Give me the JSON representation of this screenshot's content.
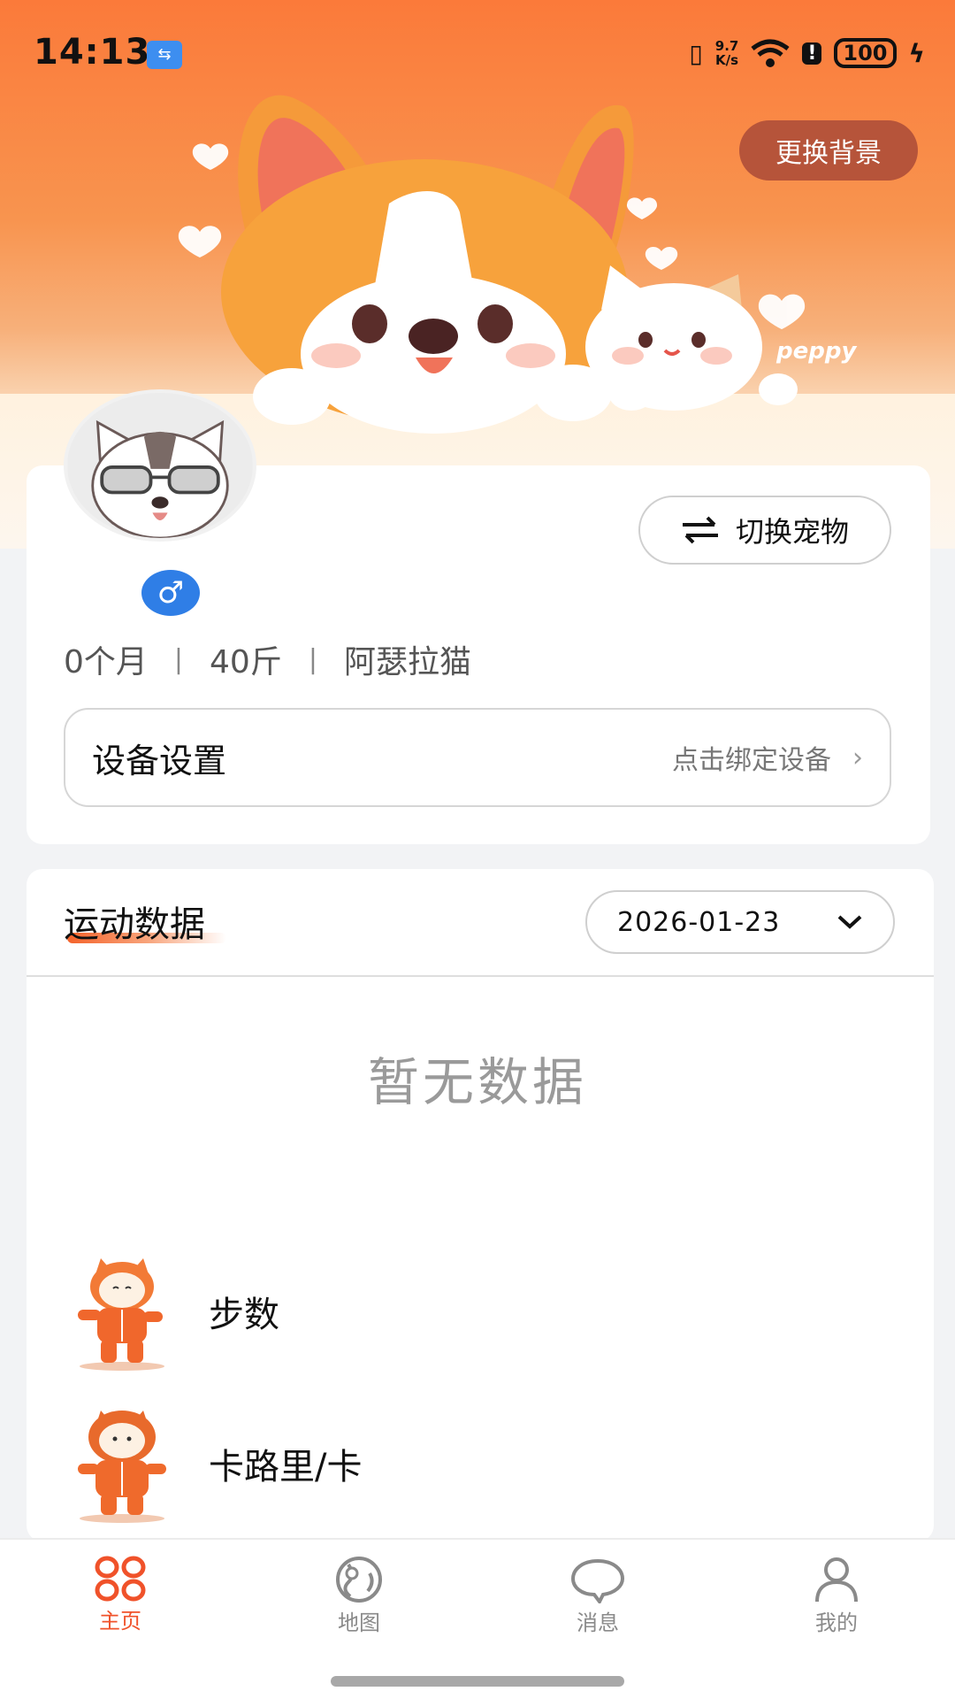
{
  "status_bar": {
    "time": "14:13",
    "net_speed_top": "9.7",
    "net_speed_bottom": "K/s",
    "battery": "100",
    "icons": [
      "usb-icon",
      "vibrate-icon",
      "wifi-icon",
      "alert-icon",
      "battery-icon",
      "charging-icon"
    ]
  },
  "banner": {
    "change_background_label": "更换背景",
    "brand_text": "peppy"
  },
  "profile": {
    "switch_pet_label": "切换宠物",
    "gender_symbol": "♂",
    "age": "0个月",
    "weight": "40斤",
    "breed": "阿瑟拉猫",
    "separator": "|",
    "device_title": "设备设置",
    "device_hint": "点击绑定设备",
    "chevron": "›"
  },
  "sport": {
    "title": "运动数据",
    "date": "2026-01-23",
    "empty_text": "暂无数据",
    "metrics": [
      {
        "label": "步数"
      },
      {
        "label": "卡路里/卡"
      }
    ]
  },
  "nav": {
    "items": [
      {
        "label": "主页",
        "icon": "home-grid-icon",
        "active": true
      },
      {
        "label": "地图",
        "icon": "map-icon",
        "active": false
      },
      {
        "label": "消息",
        "icon": "message-icon",
        "active": false
      },
      {
        "label": "我的",
        "icon": "profile-icon",
        "active": false
      }
    ]
  },
  "colors": {
    "accent": "#f0522a",
    "banner_orange": "#fb7a3a",
    "gender_blue": "#2f7ee6",
    "change_bg_button": "#b6543a"
  }
}
